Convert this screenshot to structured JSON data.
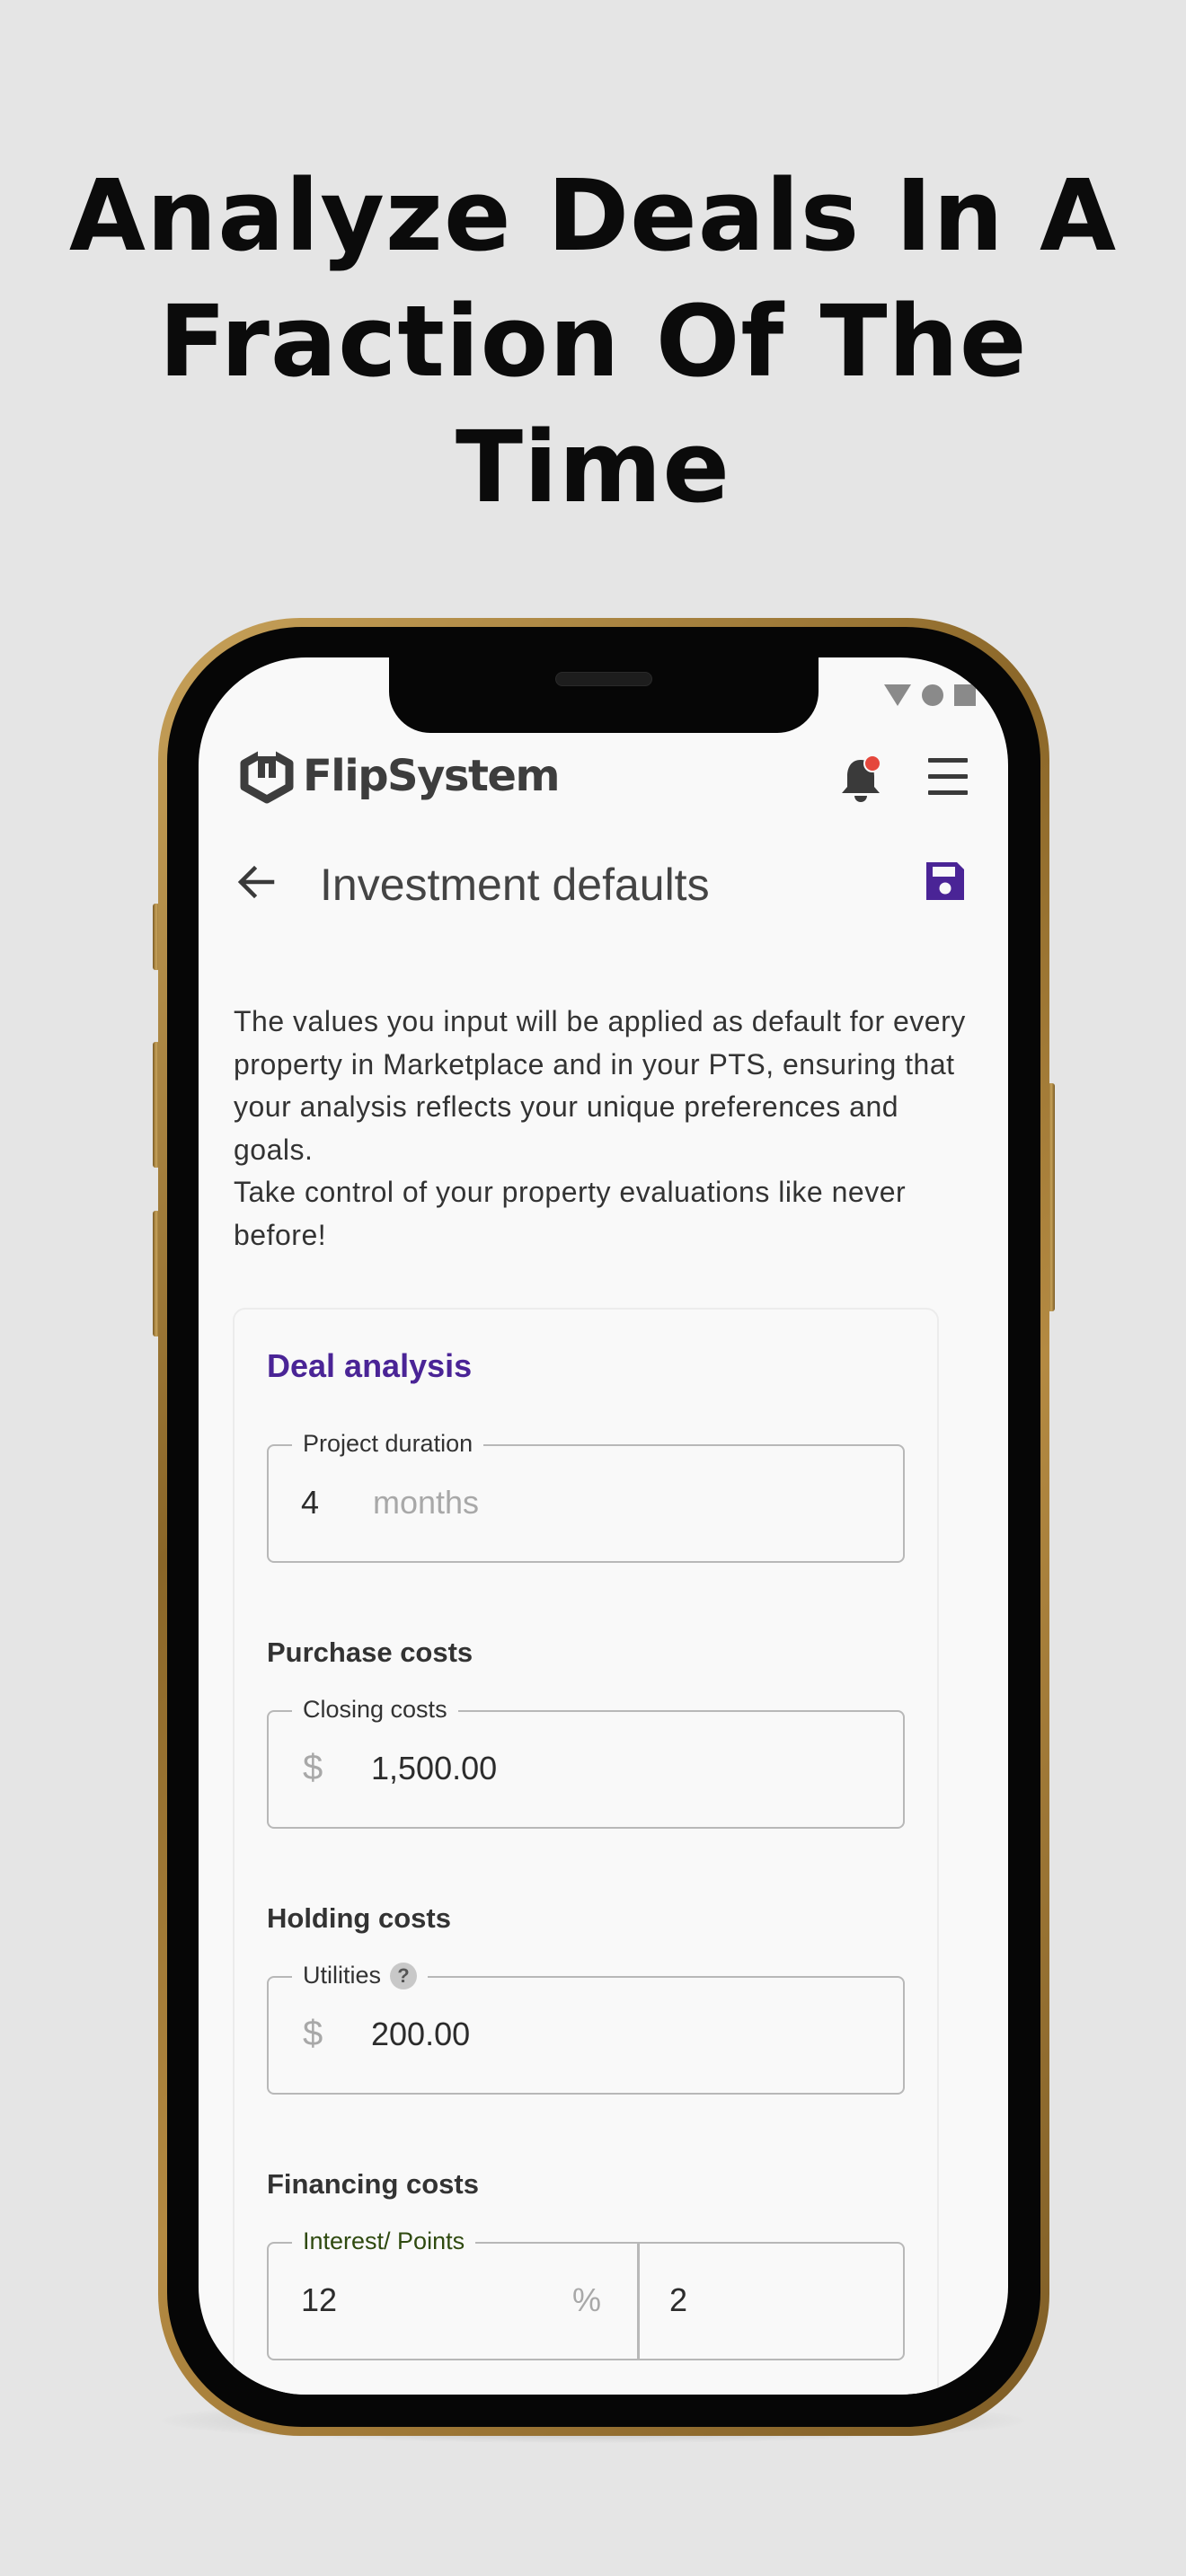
{
  "headline": {
    "line1": "Analyze Deals In A",
    "line2": "Fraction Of The",
    "line3": "Time"
  },
  "app": {
    "logo_text": "FlipSystem",
    "notification_dot_color": "#e5473c",
    "accent_color": "#4a2496"
  },
  "page": {
    "title": "Investment defaults",
    "intro_line1": "The values you input will be applied as default for every property in Marketplace and in your PTS, ensuring that your analysis reflects your unique preferences and goals.",
    "intro_line2": "Take control of your property evaluations like never before!"
  },
  "deal_analysis": {
    "title": "Deal analysis",
    "project_duration": {
      "label": "Project duration",
      "value": "4",
      "unit": "months"
    },
    "purchase_costs": {
      "title": "Purchase costs",
      "closing_costs": {
        "label": "Closing costs",
        "prefix": "$",
        "value": "1,500.00"
      }
    },
    "holding_costs": {
      "title": "Holding costs",
      "utilities": {
        "label": "Utilities",
        "help": "?",
        "prefix": "$",
        "value": "200.00"
      }
    },
    "financing_costs": {
      "title": "Financing costs",
      "interest_points": {
        "label": "Interest/ Points",
        "interest_value": "12",
        "interest_suffix": "%",
        "points_value": "2"
      }
    }
  }
}
